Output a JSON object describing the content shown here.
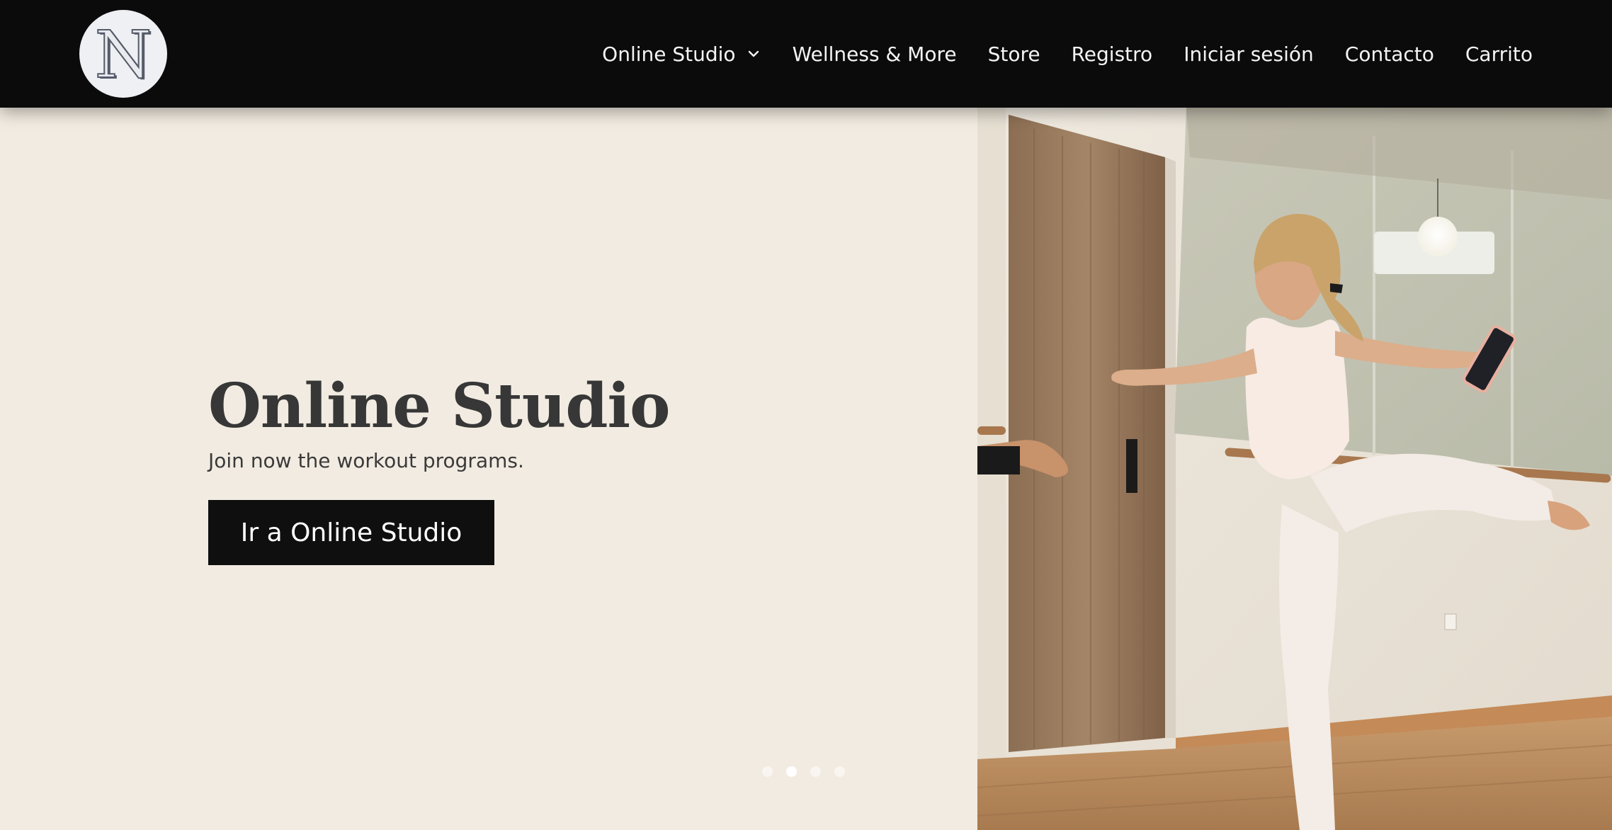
{
  "header": {
    "logo_letter": "N",
    "nav": [
      {
        "label": "Online Studio",
        "has_dropdown": true
      },
      {
        "label": "Wellness & More"
      },
      {
        "label": "Store"
      },
      {
        "label": "Registro"
      },
      {
        "label": "Iniciar sesión"
      },
      {
        "label": "Contacto"
      },
      {
        "label": "Carrito"
      }
    ]
  },
  "hero": {
    "title": "Online Studio",
    "subtitle": "Join now the workout programs.",
    "button_label": "Ir a Online Studio",
    "slides_total": 4,
    "active_slide": 2,
    "photo_icon": "woman-doing-barre-workout-with-phone-photo"
  },
  "colors": {
    "header_bg": "#0b0b0b",
    "hero_bg": "#f2ebe1",
    "title": "#373737",
    "button_bg": "#0f0f0f",
    "logo_bg": "#eef0f3",
    "logo_letter": "#565b6a"
  }
}
